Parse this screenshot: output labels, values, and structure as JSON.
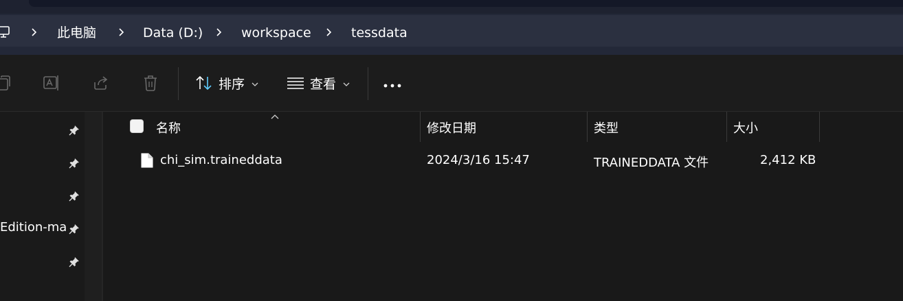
{
  "breadcrumb": {
    "root_icon": "computer-icon",
    "items": [
      "此电脑",
      "Data (D:)",
      "workspace",
      "tessdata"
    ]
  },
  "toolbar": {
    "copy_icon": "copy-icon",
    "rename_icon": "rename-icon",
    "share_icon": "share-icon",
    "delete_icon": "delete-icon",
    "sort_label": "排序",
    "view_label": "查看",
    "more_icon": "more-icon"
  },
  "nav": {
    "items": [
      {
        "label": "",
        "pinned": true
      },
      {
        "label": "",
        "pinned": true
      },
      {
        "label": "",
        "pinned": true
      },
      {
        "label": "Edition-mai",
        "pinned": true
      },
      {
        "label": "",
        "pinned": true
      }
    ]
  },
  "columns": {
    "name": "名称",
    "modified": "修改日期",
    "type": "类型",
    "size": "大小"
  },
  "files": [
    {
      "name": "chi_sim.traineddata",
      "modified": "2024/3/16 15:47",
      "type": "TRAINEDDATA 文件",
      "size": "2,412 KB",
      "icon": "file-icon"
    }
  ],
  "colors": {
    "background": "#191919",
    "address_bar": "#2b3040",
    "accent_blue": "#60cdff"
  }
}
